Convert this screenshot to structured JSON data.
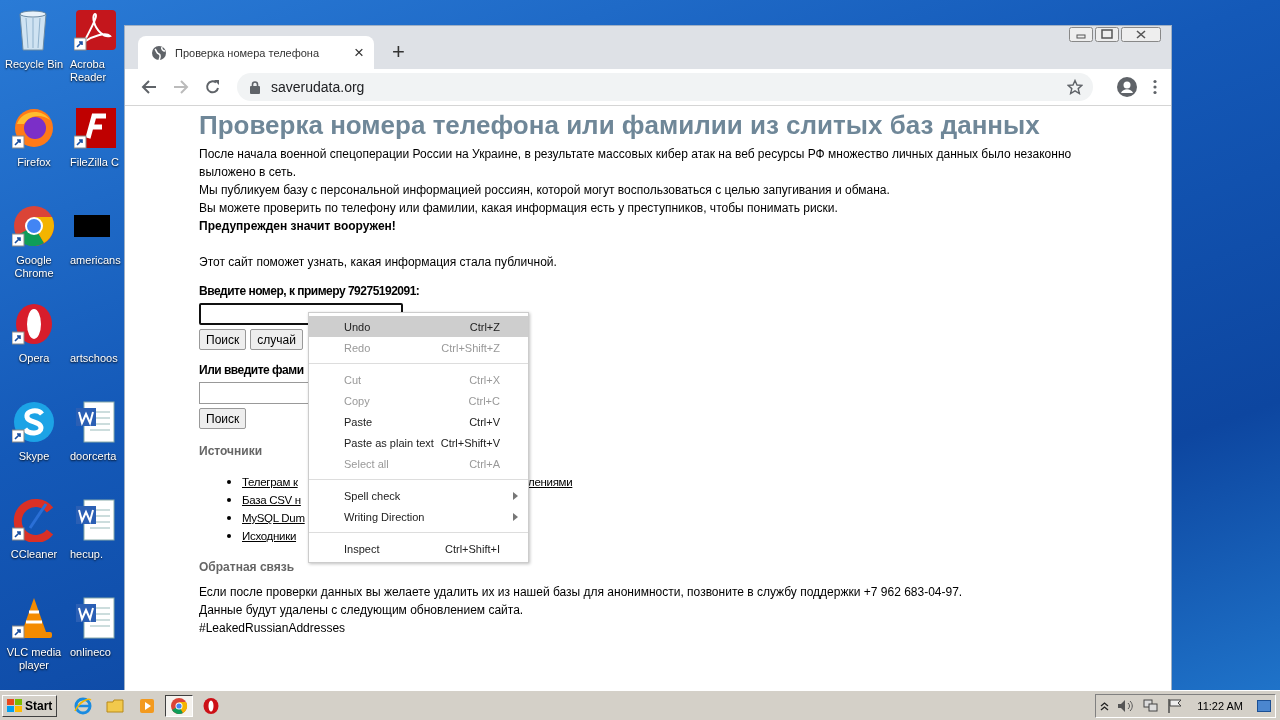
{
  "desktop": {
    "icons": [
      {
        "label": "Recycle Bin",
        "kind": "bin"
      },
      {
        "label": "Acroba\nReader",
        "kind": "pdf"
      },
      {
        "label": "Firefox",
        "kind": "firefox"
      },
      {
        "label": "FileZilla C",
        "kind": "filezilla"
      },
      {
        "label": "Google\nChrome",
        "kind": "chrome"
      },
      {
        "label": "americans",
        "kind": "thumb"
      },
      {
        "label": "Opera",
        "kind": "opera"
      },
      {
        "label": "artschoos",
        "kind": "none"
      },
      {
        "label": "Skype",
        "kind": "skype"
      },
      {
        "label": "doorcerta",
        "kind": "word"
      },
      {
        "label": "CCleaner",
        "kind": "ccleaner"
      },
      {
        "label": "hecup.",
        "kind": "word"
      },
      {
        "label": "VLC media\nplayer",
        "kind": "vlc"
      },
      {
        "label": "onlineco",
        "kind": "word"
      }
    ]
  },
  "browser": {
    "tab": {
      "title": "Проверка номера телефона",
      "close": "×"
    },
    "new_tab": "+",
    "address": "saverudata.org"
  },
  "page": {
    "title": "Проверка номера телефона или фамилии из слитых баз данных",
    "paragraphs": [
      {
        "text": "После начала военной спецоперации России на Украине, в результате массовых кибер атак на веб ресурсы РФ множество личных данных было незаконно выложено в сеть.",
        "bold": false
      },
      {
        "text": "Мы публикуем базу с персональной информацией россиян, которой могут воспользоваться с целью запугивания и обмана.",
        "bold": false
      },
      {
        "text": "Вы можете проверить по телефону или фамилии, какая информация есть у преступников, чтобы понимать риски.",
        "bold": false
      },
      {
        "text": "Предупрежден значит вооружен!",
        "bold": true
      }
    ],
    "note": "Этот сайт поможет узнать, какая информация стала публичной.",
    "forms": [
      {
        "label": "Введите номер, к примеру 79275192091:",
        "focused": true,
        "buttons": [
          "Поиск",
          "случай"
        ]
      },
      {
        "label": "Или введите фами",
        "focused": false,
        "buttons": [
          "Поиск"
        ]
      }
    ],
    "sources_heading": "Источники",
    "sources": [
      {
        "text": "Телеграм к",
        "tail": "лениями"
      },
      {
        "text": "База CSV н"
      },
      {
        "text": "MySQL Dum"
      },
      {
        "text": "Исходники"
      }
    ],
    "feedback_heading": "Обратная связь",
    "feedback": [
      "Если после проверки данных вы желаете удалить их из нашей базы для анонимности, позвоните в службу поддержки +7 962 683-04-97.",
      "Данные будут удалены с следующим обновлением сайта.",
      "#LeakedRussianAddresses"
    ]
  },
  "context_menu": {
    "groups": [
      [
        {
          "label": "Undo",
          "shortcut": "Ctrl+Z",
          "kind": "command",
          "disabled": false,
          "selected": true
        },
        {
          "label": "Redo",
          "shortcut": "Ctrl+Shift+Z",
          "kind": "command",
          "disabled": true,
          "selected": false
        }
      ],
      [
        {
          "label": "Cut",
          "shortcut": "Ctrl+X",
          "kind": "command",
          "disabled": true,
          "selected": false
        },
        {
          "label": "Copy",
          "shortcut": "Ctrl+C",
          "kind": "command",
          "disabled": true,
          "selected": false
        },
        {
          "label": "Paste",
          "shortcut": "Ctrl+V",
          "kind": "command",
          "disabled": false,
          "selected": false
        },
        {
          "label": "Paste as plain text",
          "shortcut": "Ctrl+Shift+V",
          "kind": "command",
          "disabled": false,
          "selected": false
        },
        {
          "label": "Select all",
          "shortcut": "Ctrl+A",
          "kind": "command",
          "disabled": true,
          "selected": false
        }
      ],
      [
        {
          "label": "Spell check",
          "kind": "submenu",
          "disabled": false,
          "selected": false
        },
        {
          "label": "Writing Direction",
          "kind": "submenu",
          "disabled": false,
          "selected": false
        }
      ],
      [
        {
          "label": "Inspect",
          "shortcut": "Ctrl+Shift+I",
          "kind": "command",
          "disabled": false,
          "selected": false
        }
      ]
    ]
  },
  "taskbar": {
    "start": "Start",
    "apps": [
      {
        "kind": "ie",
        "selected": false
      },
      {
        "kind": "folder",
        "selected": false
      },
      {
        "kind": "media",
        "selected": false
      },
      {
        "kind": "chrome",
        "selected": true
      },
      {
        "kind": "opera",
        "selected": false
      }
    ],
    "clock": "11:22 AM"
  }
}
